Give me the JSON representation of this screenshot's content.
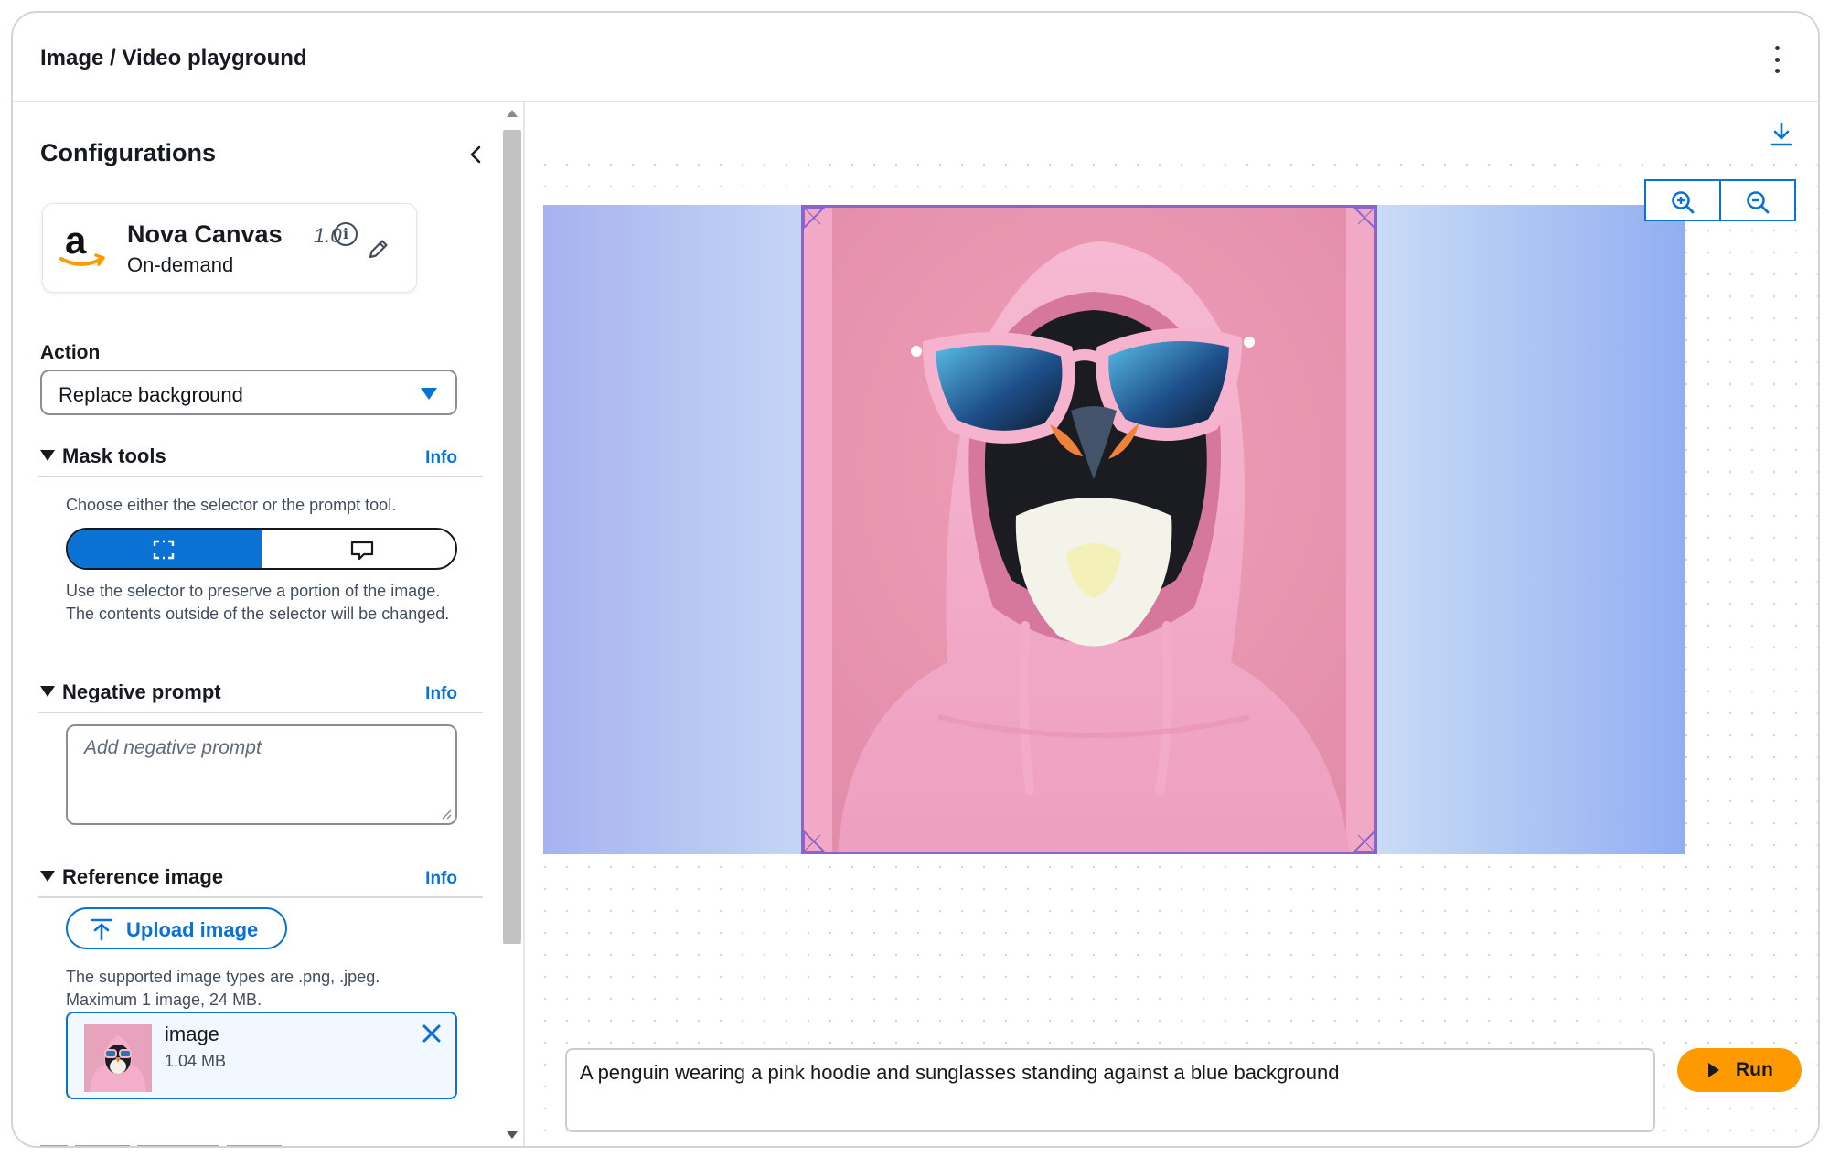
{
  "header": {
    "title": "Image / Video playground"
  },
  "config": {
    "title": "Configurations",
    "model": {
      "name": "Nova Canvas",
      "version": "1.0",
      "mode": "On-demand"
    },
    "action": {
      "label": "Action",
      "value": "Replace background"
    },
    "mask_tools": {
      "title": "Mask tools",
      "info": "Info",
      "hint": "Choose either the selector or the prompt tool.",
      "selected_tool": "selector",
      "description": "Use the selector to preserve a portion of the image. The contents outside of the selector will be changed."
    },
    "negative_prompt": {
      "title": "Negative prompt",
      "info": "Info",
      "placeholder": "Add negative prompt"
    },
    "reference_image": {
      "title": "Reference image",
      "info": "Info",
      "upload_label": "Upload image",
      "supported_types": "The supported image types are .png, .jpeg.",
      "limit": "Maximum 1 image, 24 MB.",
      "file": {
        "name": "image",
        "size": "1.04 MB"
      }
    }
  },
  "canvas": {
    "prompt": "A penguin wearing a pink hoodie and sunglasses standing against a blue background",
    "run_label": "Run"
  },
  "colors": {
    "accent": "#0972d3",
    "run": "#ff9900",
    "selector_frame": "#8a65c9"
  }
}
